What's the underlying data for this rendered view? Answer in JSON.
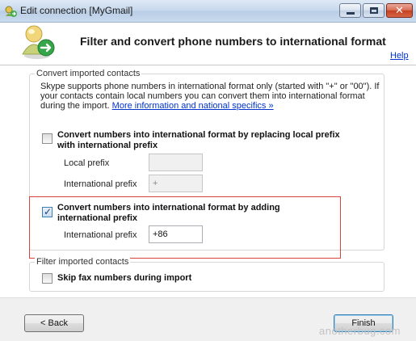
{
  "window": {
    "title": "Edit connection [MyGmail]",
    "controls": {
      "minimize_icon": "minimize-icon",
      "maximize_icon": "maximize-icon",
      "close_icon": "close-icon"
    }
  },
  "header": {
    "title": "Filter and convert phone numbers to international format",
    "help_label": "Help",
    "icon": "user-convert-icon"
  },
  "convert_group": {
    "legend": "Convert imported contacts",
    "info_text": "Skype supports phone numbers in international format only (started with \"+\" or \"00\"). If your contacts contain local numbers you can convert them into international format during the import.",
    "info_link": "More information and national specifics »",
    "option_replace": {
      "label": "Convert numbers into international format by replacing local prefix with international prefix",
      "checked": false,
      "local_prefix_label": "Local prefix",
      "local_prefix_value": "",
      "intl_prefix_label": "International prefix",
      "intl_prefix_value": "+"
    },
    "option_add": {
      "label": "Convert numbers into international format by adding international prefix",
      "checked": true,
      "intl_prefix_label": "International prefix",
      "intl_prefix_value": "+86"
    }
  },
  "filter_group": {
    "legend": "Filter imported contacts",
    "skip_fax_label": "Skip fax numbers during import",
    "skip_fax_checked": false
  },
  "footer": {
    "back_label": "< Back",
    "finish_label": "Finish"
  },
  "watermark": "anotherbug.com",
  "colors": {
    "link": "#0033cc",
    "highlight_border": "#d9443a",
    "titlebar": "#c6d7ec",
    "close_button": "#c4401f"
  }
}
